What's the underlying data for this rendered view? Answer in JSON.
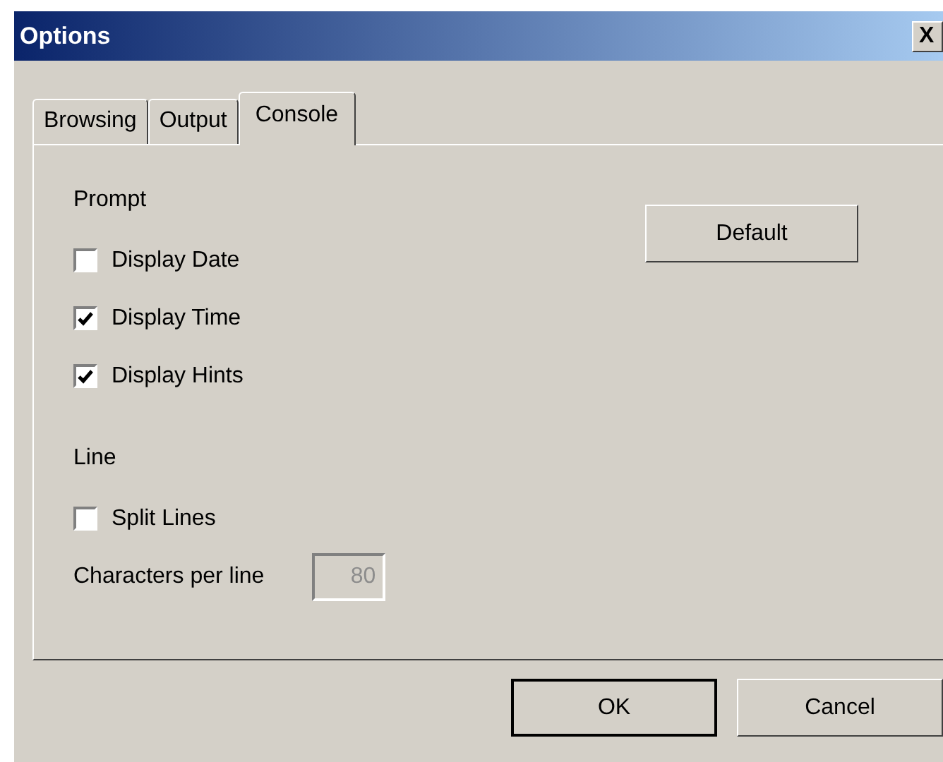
{
  "window": {
    "title": "Options",
    "close_label": "X"
  },
  "tabs": [
    {
      "label": "Browsing",
      "selected": false
    },
    {
      "label": "Output",
      "selected": false
    },
    {
      "label": "Console",
      "selected": true
    }
  ],
  "sections": [
    {
      "heading": "Prompt",
      "items": [
        {
          "kind": "checkbox",
          "label": "Display Date",
          "checked": false
        },
        {
          "kind": "checkbox",
          "label": "Display Time",
          "checked": true
        },
        {
          "kind": "checkbox",
          "label": "Display Hints",
          "checked": true
        }
      ]
    },
    {
      "heading": "Line",
      "items": [
        {
          "kind": "checkbox",
          "label": "Split Lines",
          "checked": false
        },
        {
          "kind": "field",
          "label": "Characters per line",
          "value": "80",
          "disabled": true
        }
      ]
    }
  ],
  "side_button": "Default",
  "buttons": [
    {
      "label": "OK",
      "default": true
    },
    {
      "label": "Cancel",
      "default": false
    }
  ]
}
